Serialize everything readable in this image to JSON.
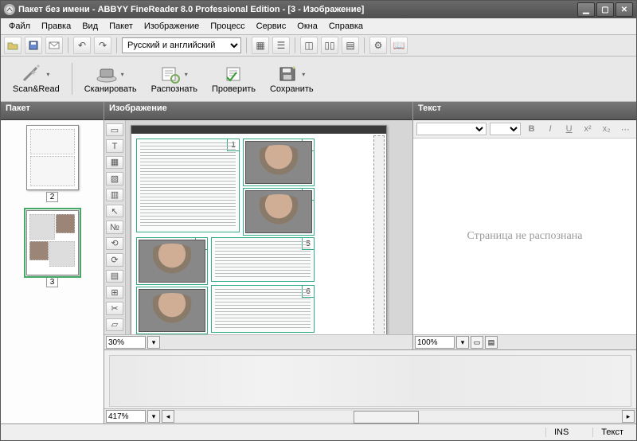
{
  "title": "Пакет без имени - ABBYY FineReader 8.0 Professional Edition - [3 - Изображение]",
  "menu": [
    "Файл",
    "Правка",
    "Вид",
    "Пакет",
    "Изображение",
    "Процесс",
    "Сервис",
    "Окна",
    "Справка"
  ],
  "toolbar_icons": [
    "open",
    "save",
    "mail",
    "sep",
    "undo",
    "redo",
    "sep",
    "languages",
    "sep",
    "view-thumbs",
    "view-details",
    "sep",
    "layout-1",
    "layout-2",
    "layout-3",
    "sep",
    "options",
    "dictionary"
  ],
  "language_selected": "Русский и английский",
  "big_buttons": {
    "scanread": "Scan&Read",
    "scan": "Сканировать",
    "read": "Распознать",
    "check": "Проверить",
    "save": "Сохранить"
  },
  "panes": {
    "batch": {
      "title": "Пакет",
      "pages": [
        {
          "num": "2",
          "selected": false
        },
        {
          "num": "3",
          "selected": true
        }
      ]
    },
    "image": {
      "title": "Изображение",
      "zoom": "30%",
      "zones": [
        "1",
        "2",
        "3",
        "4",
        "5",
        "6"
      ]
    },
    "text": {
      "title": "Текст",
      "placeholder": "Страница не распознана",
      "zoom": "100%"
    },
    "magnifier_zoom": "417%"
  },
  "image_tool_names": [
    "select",
    "zone-text",
    "zone-table",
    "zone-picture",
    "zone-barcode",
    "pointer",
    "renumber",
    "rotate-left",
    "rotate-right",
    "table-grid",
    "table-split",
    "crop",
    "eraser"
  ],
  "text_tool_names": [
    "font-family",
    "font-size",
    "bold",
    "italic",
    "underline",
    "superscript",
    "subscript",
    "options"
  ],
  "status": {
    "ins": "INS",
    "mode": "Текст"
  }
}
